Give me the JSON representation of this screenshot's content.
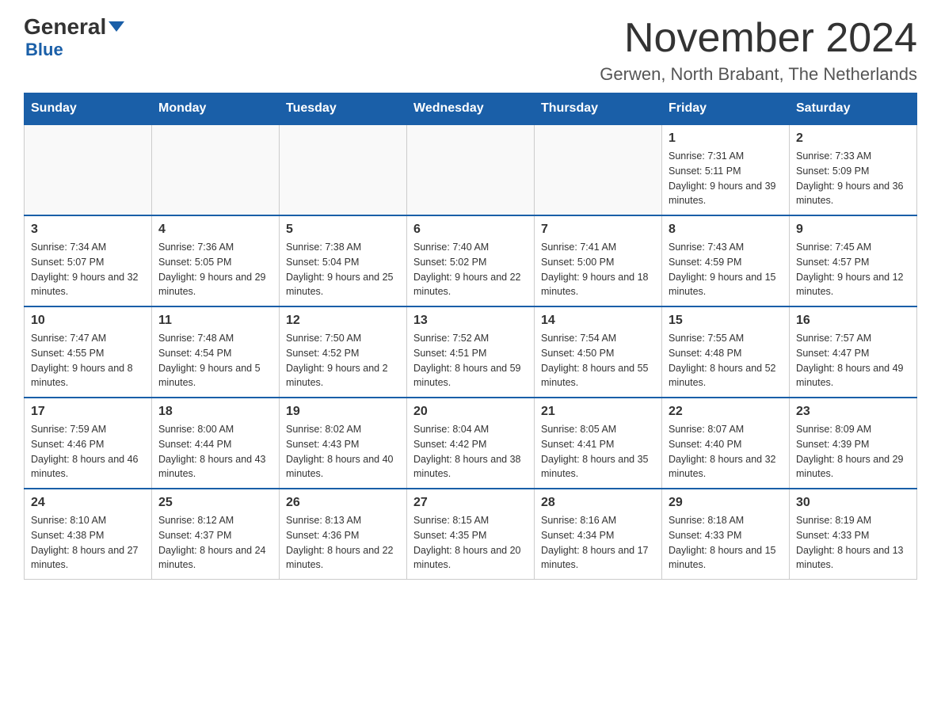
{
  "logo": {
    "part1": "General",
    "part2": "Blue"
  },
  "title": "November 2024",
  "subtitle": "Gerwen, North Brabant, The Netherlands",
  "days_of_week": [
    "Sunday",
    "Monday",
    "Tuesday",
    "Wednesday",
    "Thursday",
    "Friday",
    "Saturday"
  ],
  "weeks": [
    [
      {
        "day": "",
        "info": ""
      },
      {
        "day": "",
        "info": ""
      },
      {
        "day": "",
        "info": ""
      },
      {
        "day": "",
        "info": ""
      },
      {
        "day": "",
        "info": ""
      },
      {
        "day": "1",
        "info": "Sunrise: 7:31 AM\nSunset: 5:11 PM\nDaylight: 9 hours and 39 minutes."
      },
      {
        "day": "2",
        "info": "Sunrise: 7:33 AM\nSunset: 5:09 PM\nDaylight: 9 hours and 36 minutes."
      }
    ],
    [
      {
        "day": "3",
        "info": "Sunrise: 7:34 AM\nSunset: 5:07 PM\nDaylight: 9 hours and 32 minutes."
      },
      {
        "day": "4",
        "info": "Sunrise: 7:36 AM\nSunset: 5:05 PM\nDaylight: 9 hours and 29 minutes."
      },
      {
        "day": "5",
        "info": "Sunrise: 7:38 AM\nSunset: 5:04 PM\nDaylight: 9 hours and 25 minutes."
      },
      {
        "day": "6",
        "info": "Sunrise: 7:40 AM\nSunset: 5:02 PM\nDaylight: 9 hours and 22 minutes."
      },
      {
        "day": "7",
        "info": "Sunrise: 7:41 AM\nSunset: 5:00 PM\nDaylight: 9 hours and 18 minutes."
      },
      {
        "day": "8",
        "info": "Sunrise: 7:43 AM\nSunset: 4:59 PM\nDaylight: 9 hours and 15 minutes."
      },
      {
        "day": "9",
        "info": "Sunrise: 7:45 AM\nSunset: 4:57 PM\nDaylight: 9 hours and 12 minutes."
      }
    ],
    [
      {
        "day": "10",
        "info": "Sunrise: 7:47 AM\nSunset: 4:55 PM\nDaylight: 9 hours and 8 minutes."
      },
      {
        "day": "11",
        "info": "Sunrise: 7:48 AM\nSunset: 4:54 PM\nDaylight: 9 hours and 5 minutes."
      },
      {
        "day": "12",
        "info": "Sunrise: 7:50 AM\nSunset: 4:52 PM\nDaylight: 9 hours and 2 minutes."
      },
      {
        "day": "13",
        "info": "Sunrise: 7:52 AM\nSunset: 4:51 PM\nDaylight: 8 hours and 59 minutes."
      },
      {
        "day": "14",
        "info": "Sunrise: 7:54 AM\nSunset: 4:50 PM\nDaylight: 8 hours and 55 minutes."
      },
      {
        "day": "15",
        "info": "Sunrise: 7:55 AM\nSunset: 4:48 PM\nDaylight: 8 hours and 52 minutes."
      },
      {
        "day": "16",
        "info": "Sunrise: 7:57 AM\nSunset: 4:47 PM\nDaylight: 8 hours and 49 minutes."
      }
    ],
    [
      {
        "day": "17",
        "info": "Sunrise: 7:59 AM\nSunset: 4:46 PM\nDaylight: 8 hours and 46 minutes."
      },
      {
        "day": "18",
        "info": "Sunrise: 8:00 AM\nSunset: 4:44 PM\nDaylight: 8 hours and 43 minutes."
      },
      {
        "day": "19",
        "info": "Sunrise: 8:02 AM\nSunset: 4:43 PM\nDaylight: 8 hours and 40 minutes."
      },
      {
        "day": "20",
        "info": "Sunrise: 8:04 AM\nSunset: 4:42 PM\nDaylight: 8 hours and 38 minutes."
      },
      {
        "day": "21",
        "info": "Sunrise: 8:05 AM\nSunset: 4:41 PM\nDaylight: 8 hours and 35 minutes."
      },
      {
        "day": "22",
        "info": "Sunrise: 8:07 AM\nSunset: 4:40 PM\nDaylight: 8 hours and 32 minutes."
      },
      {
        "day": "23",
        "info": "Sunrise: 8:09 AM\nSunset: 4:39 PM\nDaylight: 8 hours and 29 minutes."
      }
    ],
    [
      {
        "day": "24",
        "info": "Sunrise: 8:10 AM\nSunset: 4:38 PM\nDaylight: 8 hours and 27 minutes."
      },
      {
        "day": "25",
        "info": "Sunrise: 8:12 AM\nSunset: 4:37 PM\nDaylight: 8 hours and 24 minutes."
      },
      {
        "day": "26",
        "info": "Sunrise: 8:13 AM\nSunset: 4:36 PM\nDaylight: 8 hours and 22 minutes."
      },
      {
        "day": "27",
        "info": "Sunrise: 8:15 AM\nSunset: 4:35 PM\nDaylight: 8 hours and 20 minutes."
      },
      {
        "day": "28",
        "info": "Sunrise: 8:16 AM\nSunset: 4:34 PM\nDaylight: 8 hours and 17 minutes."
      },
      {
        "day": "29",
        "info": "Sunrise: 8:18 AM\nSunset: 4:33 PM\nDaylight: 8 hours and 15 minutes."
      },
      {
        "day": "30",
        "info": "Sunrise: 8:19 AM\nSunset: 4:33 PM\nDaylight: 8 hours and 13 minutes."
      }
    ]
  ]
}
